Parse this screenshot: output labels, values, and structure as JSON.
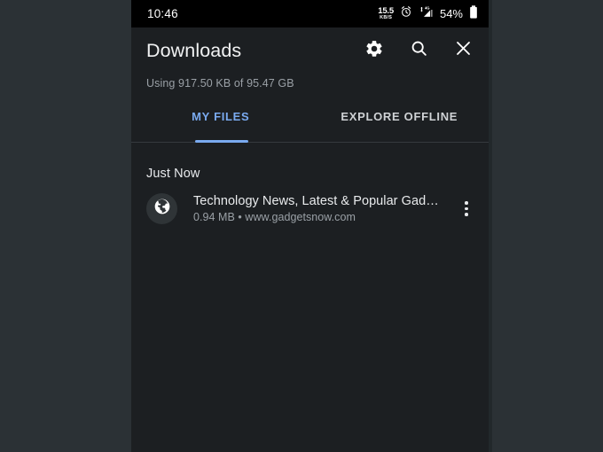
{
  "status_bar": {
    "time": "10:46",
    "net_speed_value": "15.5",
    "net_speed_unit": "KB/S",
    "alarm_icon": "alarm-clock-icon",
    "signal_icon": "mobile-signal-4g-icon",
    "signal_label": "4G",
    "battery_percent": "54%",
    "battery_icon": "battery-icon"
  },
  "app_bar": {
    "title": "Downloads",
    "actions": [
      {
        "name": "settings-button",
        "icon": "gear-icon"
      },
      {
        "name": "search-button",
        "icon": "search-icon"
      },
      {
        "name": "close-button",
        "icon": "close-icon"
      }
    ]
  },
  "storage": {
    "text": "Using 917.50 KB of 95.47 GB"
  },
  "tabs": [
    {
      "label": "MY FILES",
      "active": true
    },
    {
      "label": "EXPLORE OFFLINE",
      "active": false
    }
  ],
  "content": {
    "section_header": "Just Now",
    "files": [
      {
        "icon": "globe-icon",
        "title": "Technology News, Latest & Popular Gad…",
        "size": "0.94 MB",
        "separator": "•",
        "source": "www.gadgetsnow.com",
        "subtitle": "0.94 MB • www.gadgetsnow.com",
        "menu_icon": "overflow-menu-icon"
      }
    ]
  },
  "colors": {
    "frame_background": "#2b3135",
    "screen_background": "#1c1f22",
    "status_bar_background": "#000000",
    "accent": "#7aaaf0",
    "primary_text": "#e9ebed",
    "secondary_text": "#9aa0a6"
  }
}
